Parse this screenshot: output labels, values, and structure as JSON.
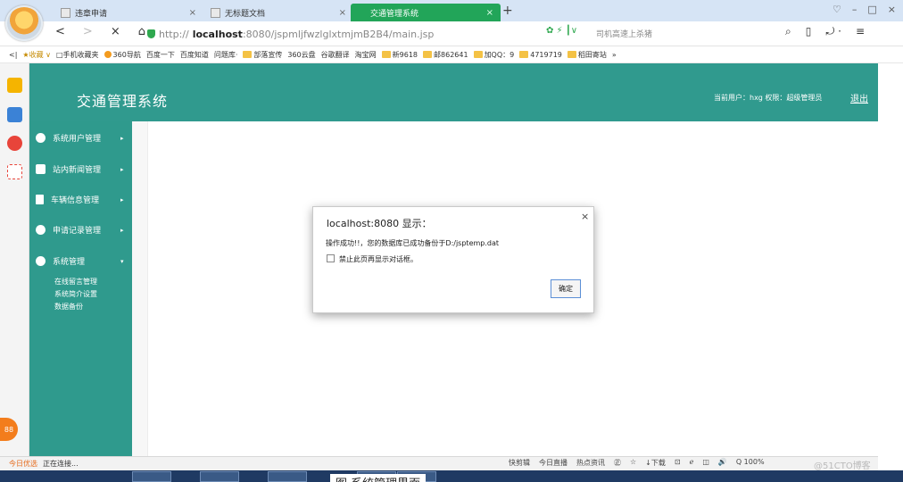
{
  "browser": {
    "tabs": [
      {
        "label": "违章申请",
        "close": "×",
        "active": false
      },
      {
        "label": "无标题文档",
        "close": "×",
        "active": false
      },
      {
        "label": "交通管理系统",
        "close": "×",
        "active": true
      }
    ],
    "new_tab": "+",
    "window_controls": [
      "♡",
      "–",
      "□",
      "×"
    ],
    "nav_buttons": [
      "<",
      ">",
      "×",
      "⌂"
    ],
    "url_prefix": "http://",
    "url_host": "localhost",
    "url_rest": ":8080/jspmljfwzlglxtmjmB2B4/main.jsp",
    "url_icons": "✿ ⚡ ┃∨",
    "search_placeholder": "司机高速上杀猪",
    "nav_right": [
      "⌕",
      "▯",
      "⤾ ·",
      "≡"
    ],
    "bookmarks": [
      "<|",
      "★收藏 ∨",
      "□手机收藏夹",
      "360导航",
      "百度一下",
      "百度知道",
      "问题库·",
      "部落宣传",
      "360云盘",
      "谷歌翻译",
      "淘宝网",
      "新9618",
      "邮862641",
      "加QQ：9",
      "4719719",
      "稻田寄站",
      "»"
    ]
  },
  "app": {
    "title": "交通管理系统",
    "user_info": "当前用户：hxg  权限：超级管理员",
    "logout": "退出",
    "menu": [
      {
        "label": "系统用户管理",
        "arrow": "▸"
      },
      {
        "label": "站内新闻管理",
        "arrow": "▸"
      },
      {
        "label": "车辆信息管理",
        "arrow": "▸"
      },
      {
        "label": "申请记录管理",
        "arrow": "▸"
      },
      {
        "label": "系统管理",
        "arrow": "▾"
      }
    ],
    "submenu": [
      "在线留言管理",
      "系统简介设置",
      "数据备份"
    ]
  },
  "dialog": {
    "title": "localhost:8080 显示：",
    "close": "×",
    "message": "操作成功!!，您的数据库已成功备份于D:/jsptemp.dat",
    "checkbox_label": "禁止此页再显示对话框。",
    "ok_label": "确定"
  },
  "statusbar": {
    "left": [
      "今日优选",
      "正在连接..."
    ],
    "right": [
      "快剪辑",
      "今日直播",
      "热点资讯",
      "㊣",
      "☆",
      "↓下载",
      "⊡",
      "ℯ",
      "◫",
      "🔊",
      "Q 100%"
    ]
  },
  "badge": "88",
  "watermark": "@51CTO博客",
  "caption": "图    系统管理界面"
}
